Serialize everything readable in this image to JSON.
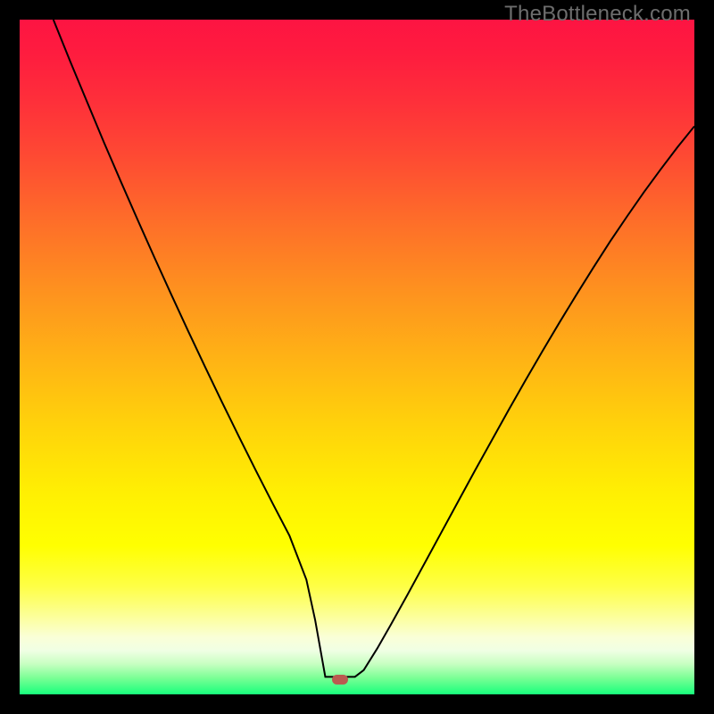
{
  "watermark": {
    "text": "TheBottleneck.com"
  },
  "chart_data": {
    "type": "line",
    "title": "",
    "xlabel": "",
    "ylabel": "",
    "xlim": [
      0,
      100
    ],
    "ylim": [
      0,
      100
    ],
    "grid": false,
    "background_gradient": {
      "stops": [
        {
          "offset": 0.0,
          "color": "#fd1442"
        },
        {
          "offset": 0.05,
          "color": "#fe1c3f"
        },
        {
          "offset": 0.12,
          "color": "#fe2f3a"
        },
        {
          "offset": 0.2,
          "color": "#fe4933"
        },
        {
          "offset": 0.3,
          "color": "#fe6e29"
        },
        {
          "offset": 0.4,
          "color": "#fe911f"
        },
        {
          "offset": 0.5,
          "color": "#ffb215"
        },
        {
          "offset": 0.6,
          "color": "#ffd20b"
        },
        {
          "offset": 0.7,
          "color": "#ffef03"
        },
        {
          "offset": 0.78,
          "color": "#ffff01"
        },
        {
          "offset": 0.84,
          "color": "#feff46"
        },
        {
          "offset": 0.885,
          "color": "#fcff9b"
        },
        {
          "offset": 0.915,
          "color": "#faffd7"
        },
        {
          "offset": 0.935,
          "color": "#f0ffe4"
        },
        {
          "offset": 0.955,
          "color": "#c7ffc1"
        },
        {
          "offset": 0.975,
          "color": "#7dff96"
        },
        {
          "offset": 1.0,
          "color": "#18ff7c"
        }
      ]
    },
    "series": [
      {
        "name": "bottleneck-curve",
        "color": "#000000",
        "width": 2,
        "x": [
          5,
          7.5,
          10,
          12.5,
          15,
          17.5,
          20,
          22.5,
          25,
          27.5,
          30,
          32.5,
          35,
          37.5,
          40,
          42.5,
          43.8,
          45.3,
          49.7,
          51,
          53,
          55,
          57.5,
          60,
          62.5,
          65,
          67.5,
          70,
          72.5,
          75,
          77.5,
          80,
          82.5,
          85,
          87.5,
          90,
          92.5,
          95,
          97.5,
          100
        ],
        "y": [
          100,
          93.8,
          87.8,
          81.8,
          76.0,
          70.3,
          64.7,
          59.2,
          53.8,
          48.5,
          43.3,
          38.2,
          33.2,
          28.3,
          23.5,
          17.0,
          11.0,
          2.6,
          2.6,
          3.6,
          6.8,
          10.3,
          14.8,
          19.4,
          24.0,
          28.6,
          33.2,
          37.7,
          42.2,
          46.6,
          50.9,
          55.1,
          59.2,
          63.2,
          67.1,
          70.8,
          74.4,
          77.8,
          81.1,
          84.2
        ]
      }
    ],
    "marker": {
      "name": "optimum-marker",
      "x": 47.5,
      "y": 2.2,
      "width_pct": 2.4,
      "height_pct": 1.45,
      "color": "#ba5a50"
    }
  }
}
